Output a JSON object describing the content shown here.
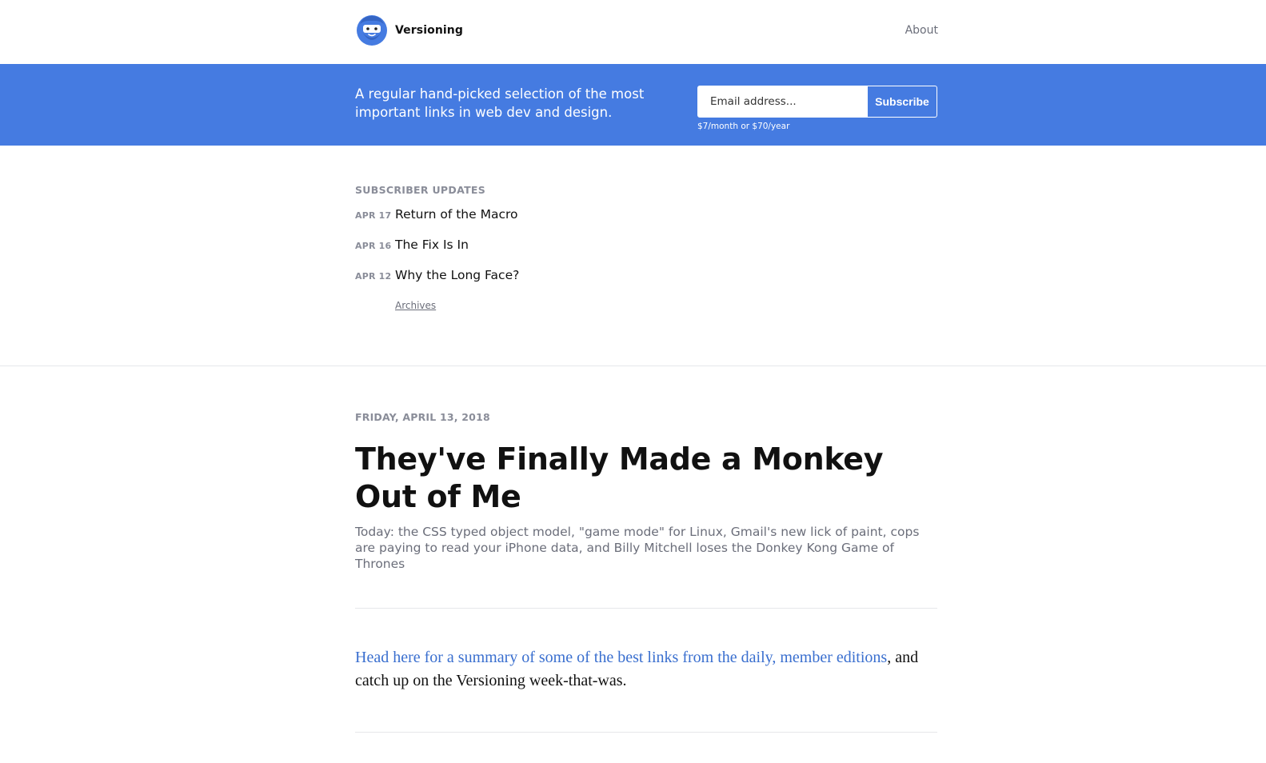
{
  "header": {
    "brand_name": "Versioning",
    "about_label": "About"
  },
  "banner": {
    "tagline": "A regular hand-picked selection of the most important links in web dev and design.",
    "email_placeholder": "Email address...",
    "subscribe_label": "Subscribe",
    "price_note": "$7/month or $70/year"
  },
  "updates": {
    "heading": "SUBSCRIBER UPDATES",
    "items": [
      {
        "date": "APR 17",
        "title": "Return of the Macro"
      },
      {
        "date": "APR 16",
        "title": "The Fix Is In"
      },
      {
        "date": "APR 12",
        "title": "Why the Long Face?"
      }
    ],
    "archives_label": "Archives"
  },
  "article": {
    "date": "FRIDAY, APRIL 13, 2018",
    "title": "They've Finally Made a Monkey Out of Me",
    "summary": "Today: the CSS typed object model, \"game mode\" for Linux, Gmail's new lick of paint, cops are paying to read your iPhone data, and Billy Mitchell loses the Donkey Kong Game of Thrones",
    "intro_link": "Head here for a summary of some of the best links from the daily, member editions",
    "intro_rest": ", and catch up on the Versioning week-that-was."
  },
  "colors": {
    "accent": "#457be1",
    "link": "#3a6fcf",
    "muted": "#8a8d99"
  },
  "icons": {
    "logo": "bearded-face-logo-icon"
  }
}
